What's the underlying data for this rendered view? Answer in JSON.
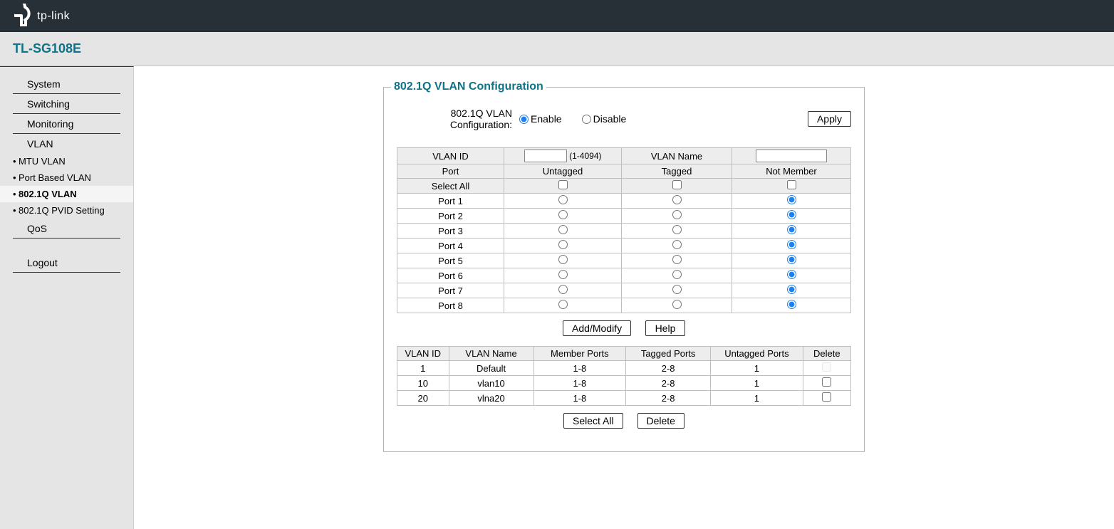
{
  "brand": "tp-link",
  "device_model": "TL-SG108E",
  "nav": {
    "system": "System",
    "switching": "Switching",
    "monitoring": "Monitoring",
    "vlan": "VLAN",
    "mtu_vlan": "MTU VLAN",
    "port_based_vlan": "Port Based VLAN",
    "dot1q_vlan": "802.1Q VLAN",
    "dot1q_pvid": "802.1Q PVID Setting",
    "qos": "QoS",
    "logout": "Logout"
  },
  "panel": {
    "title": "802.1Q VLAN Configuration"
  },
  "cfg": {
    "label": "802.1Q VLAN Configuration:",
    "enable": "Enable",
    "disable": "Disable",
    "selected": "enable",
    "apply": "Apply"
  },
  "port_table": {
    "headers": {
      "vlan_id": "VLAN ID",
      "vlan_id_range": "(1-4094)",
      "vlan_name": "VLAN Name",
      "port": "Port",
      "untagged": "Untagged",
      "tagged": "Tagged",
      "not_member": "Not Member",
      "select_all": "Select All"
    },
    "vlan_id_value": "",
    "vlan_name_value": "",
    "ports": [
      {
        "label": "Port 1",
        "state": "notmember"
      },
      {
        "label": "Port 2",
        "state": "notmember"
      },
      {
        "label": "Port 3",
        "state": "notmember"
      },
      {
        "label": "Port 4",
        "state": "notmember"
      },
      {
        "label": "Port 5",
        "state": "notmember"
      },
      {
        "label": "Port 6",
        "state": "notmember"
      },
      {
        "label": "Port 7",
        "state": "notmember"
      },
      {
        "label": "Port 8",
        "state": "notmember"
      }
    ]
  },
  "buttons": {
    "add_modify": "Add/Modify",
    "help": "Help",
    "select_all": "Select All",
    "delete": "Delete"
  },
  "vlan_list": {
    "headers": {
      "vlan_id": "VLAN ID",
      "vlan_name": "VLAN Name",
      "member": "Member Ports",
      "tagged": "Tagged Ports",
      "untagged": "Untagged Ports",
      "delete": "Delete"
    },
    "rows": [
      {
        "id": "1",
        "name": "Default",
        "member": "1-8",
        "tagged": "2-8",
        "untagged": "1",
        "deletable": false
      },
      {
        "id": "10",
        "name": "vlan10",
        "member": "1-8",
        "tagged": "2-8",
        "untagged": "1",
        "deletable": true
      },
      {
        "id": "20",
        "name": "vlna20",
        "member": "1-8",
        "tagged": "2-8",
        "untagged": "1",
        "deletable": true
      }
    ]
  }
}
